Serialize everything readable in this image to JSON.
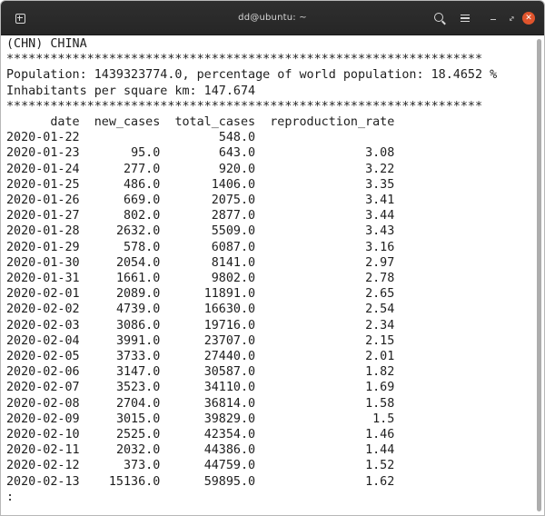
{
  "window": {
    "title": "dd@ubuntu: ~"
  },
  "icons": {
    "new_tab": "new-tab-icon",
    "search": "search-icon",
    "menu": "hamburger-menu-icon",
    "minimize": "minimize-icon",
    "maximize": "maximize-icon",
    "close": "close-icon",
    "close_color": "#e0542c"
  },
  "terminal": {
    "header": "(CHN) CHINA",
    "separator": "*****************************************************************",
    "population_line": "Population: 1439323774.0, percentage of world population: 18.4652 %",
    "density_line": "Inhabitants per square km: 147.674",
    "columns": [
      "date",
      "new_cases",
      "total_cases",
      "reproduction_rate"
    ],
    "rows": [
      [
        "2020-01-22",
        "",
        "548.0",
        ""
      ],
      [
        "2020-01-23",
        "95.0",
        "643.0",
        "3.08"
      ],
      [
        "2020-01-24",
        "277.0",
        "920.0",
        "3.22"
      ],
      [
        "2020-01-25",
        "486.0",
        "1406.0",
        "3.35"
      ],
      [
        "2020-01-26",
        "669.0",
        "2075.0",
        "3.41"
      ],
      [
        "2020-01-27",
        "802.0",
        "2877.0",
        "3.44"
      ],
      [
        "2020-01-28",
        "2632.0",
        "5509.0",
        "3.43"
      ],
      [
        "2020-01-29",
        "578.0",
        "6087.0",
        "3.16"
      ],
      [
        "2020-01-30",
        "2054.0",
        "8141.0",
        "2.97"
      ],
      [
        "2020-01-31",
        "1661.0",
        "9802.0",
        "2.78"
      ],
      [
        "2020-02-01",
        "2089.0",
        "11891.0",
        "2.65"
      ],
      [
        "2020-02-02",
        "4739.0",
        "16630.0",
        "2.54"
      ],
      [
        "2020-02-03",
        "3086.0",
        "19716.0",
        "2.34"
      ],
      [
        "2020-02-04",
        "3991.0",
        "23707.0",
        "2.15"
      ],
      [
        "2020-02-05",
        "3733.0",
        "27440.0",
        "2.01"
      ],
      [
        "2020-02-06",
        "3147.0",
        "30587.0",
        "1.82"
      ],
      [
        "2020-02-07",
        "3523.0",
        "34110.0",
        "1.69"
      ],
      [
        "2020-02-08",
        "2704.0",
        "36814.0",
        "1.58"
      ],
      [
        "2020-02-09",
        "3015.0",
        "39829.0",
        "1.5"
      ],
      [
        "2020-02-10",
        "2525.0",
        "42354.0",
        "1.46"
      ],
      [
        "2020-02-11",
        "2032.0",
        "44386.0",
        "1.44"
      ],
      [
        "2020-02-12",
        "373.0",
        "44759.0",
        "1.52"
      ],
      [
        "2020-02-13",
        "15136.0",
        "59895.0",
        "1.62"
      ]
    ],
    "prompt": ":"
  }
}
